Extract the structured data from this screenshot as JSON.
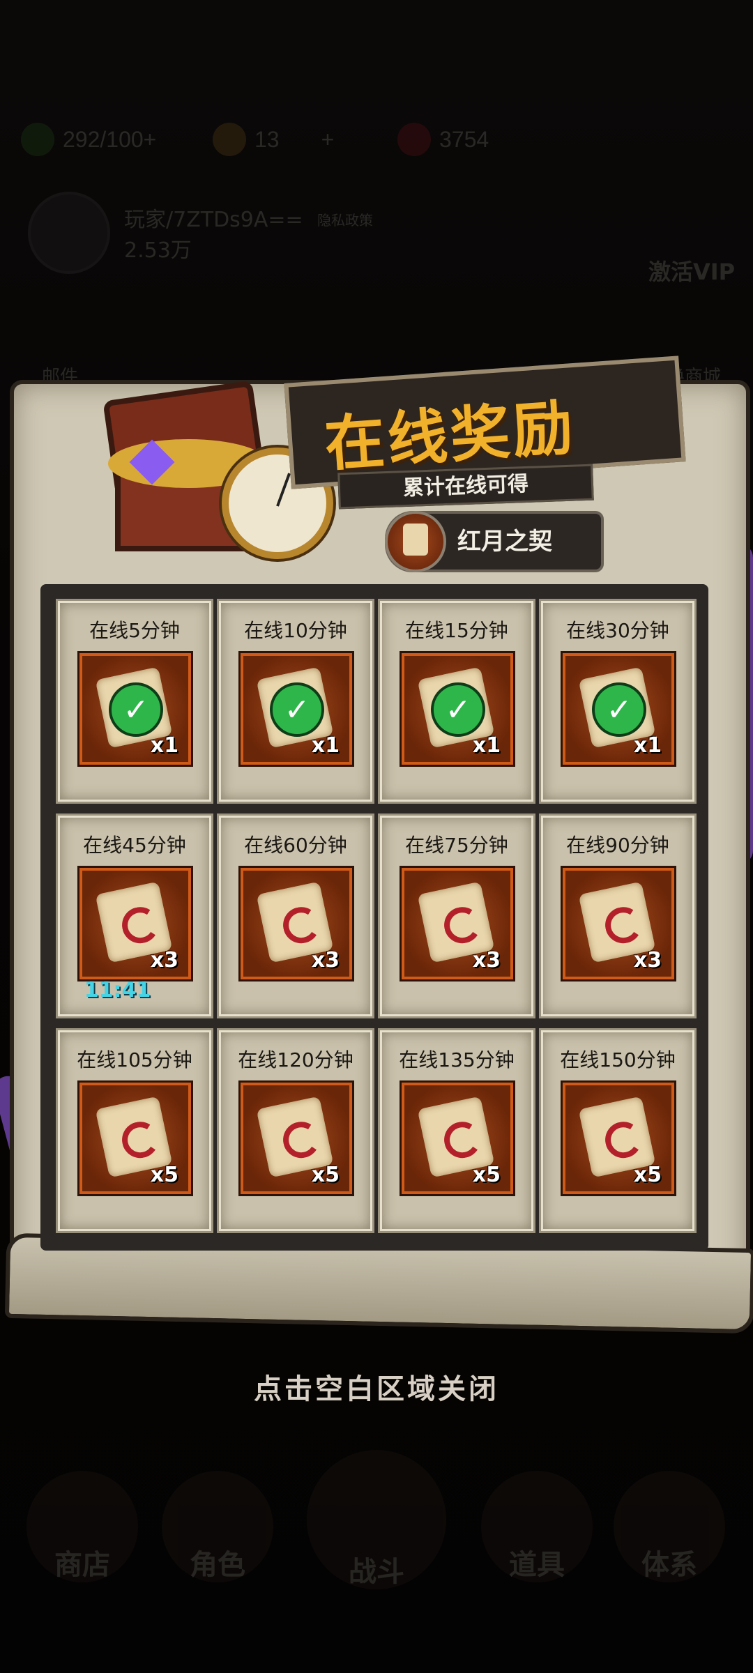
{
  "hud": {
    "energy": "292/100+",
    "gold": "13",
    "gold_plus": "+",
    "gems": "3754",
    "player_name": "玩家/7ZTDs9A==",
    "power": "2.53万",
    "privacy": "隐私政策",
    "vip": "激活VIP",
    "mail": "邮件",
    "shop2": "兑换商城"
  },
  "nav": {
    "shop": "商店",
    "role": "角色",
    "battle": "战斗",
    "items": "道具",
    "system": "体系"
  },
  "panel": {
    "title": "在线奖励",
    "subtitle": "累计在线可得",
    "reward_name": "红月之契"
  },
  "rewards": [
    {
      "label": "在线5分钟",
      "qty": "x1",
      "claimed": true
    },
    {
      "label": "在线10分钟",
      "qty": "x1",
      "claimed": true
    },
    {
      "label": "在线15分钟",
      "qty": "x1",
      "claimed": true
    },
    {
      "label": "在线30分钟",
      "qty": "x1",
      "claimed": true
    },
    {
      "label": "在线45分钟",
      "qty": "x3",
      "claimed": false,
      "timer": "11:41"
    },
    {
      "label": "在线60分钟",
      "qty": "x3",
      "claimed": false
    },
    {
      "label": "在线75分钟",
      "qty": "x3",
      "claimed": false
    },
    {
      "label": "在线90分钟",
      "qty": "x3",
      "claimed": false
    },
    {
      "label": "在线105分钟",
      "qty": "x5",
      "claimed": false
    },
    {
      "label": "在线120分钟",
      "qty": "x5",
      "claimed": false
    },
    {
      "label": "在线135分钟",
      "qty": "x5",
      "claimed": false
    },
    {
      "label": "在线150分钟",
      "qty": "x5",
      "claimed": false
    }
  ],
  "close_hint": "点击空白区域关闭",
  "colors": {
    "title": "#f2b12a",
    "timer": "#45d3e6",
    "check": "#2fb64b"
  }
}
